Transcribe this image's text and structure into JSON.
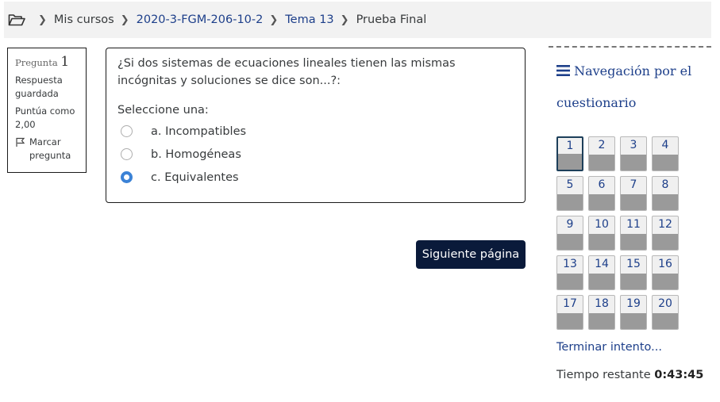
{
  "breadcrumb": {
    "items": [
      {
        "label": "Mis cursos",
        "link": false
      },
      {
        "label": "2020-3-FGM-206-10-2",
        "link": true
      },
      {
        "label": "Tema 13",
        "link": true
      },
      {
        "label": "Prueba Final",
        "link": false
      }
    ]
  },
  "question_info": {
    "label": "Pregunta",
    "number": "1",
    "status": "Respuesta guardada",
    "score": "Puntúa como 2,00",
    "flag_label": "Marcar pregunta"
  },
  "question": {
    "text": "¿Si dos sistemas de ecuaciones lineales tienen las mismas incógnitas y soluciones se dice son...?:",
    "prompt": "Seleccione una:",
    "options": [
      {
        "label": "a. Incompatibles",
        "selected": false
      },
      {
        "label": "b. Homogéneas",
        "selected": false
      },
      {
        "label": "c. Equivalentes",
        "selected": true
      }
    ]
  },
  "next_button": "Siguiente página",
  "navigation": {
    "title": "Navegación por el cuestionario",
    "icon": "hamburger-icon",
    "current": 1,
    "questions": [
      "1",
      "2",
      "3",
      "4",
      "5",
      "6",
      "7",
      "8",
      "9",
      "10",
      "11",
      "12",
      "13",
      "14",
      "15",
      "16",
      "17",
      "18",
      "19",
      "20"
    ],
    "finish_link": "Terminar intento...",
    "time_label": "Tiempo restante",
    "time_value": "0:43:45"
  }
}
